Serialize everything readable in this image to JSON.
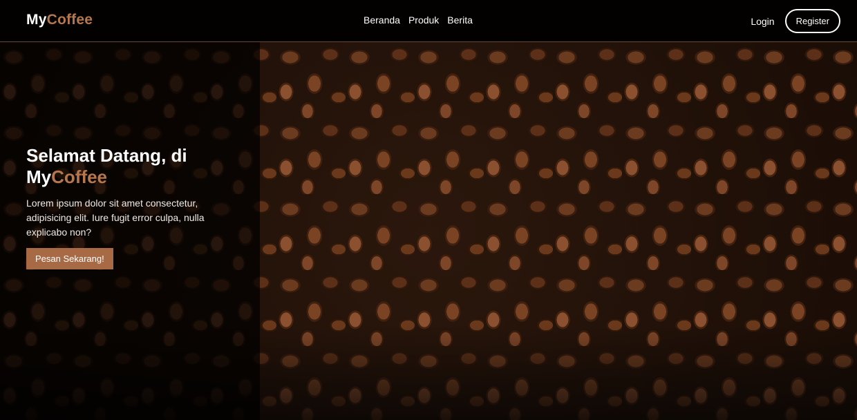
{
  "brand": {
    "prefix": "My",
    "suffix": "Coffee",
    "accent_color": "#b6774c"
  },
  "nav": {
    "links": [
      {
        "label": "Beranda"
      },
      {
        "label": "Produk"
      },
      {
        "label": "Berita"
      }
    ],
    "login_label": "Login",
    "register_label": "Register"
  },
  "hero": {
    "title_line1": "Selamat Datang, di",
    "title_prefix": "My",
    "title_suffix": "Coffee",
    "description": "Lorem ipsum dolor sit amet consectetur, adipisicing elit. Iure fugit error culpa, nulla explicabo non?",
    "cta_label": "Pesan Sekarang!",
    "cta_color": "#a86a45",
    "background": "coffee-beans-image"
  }
}
